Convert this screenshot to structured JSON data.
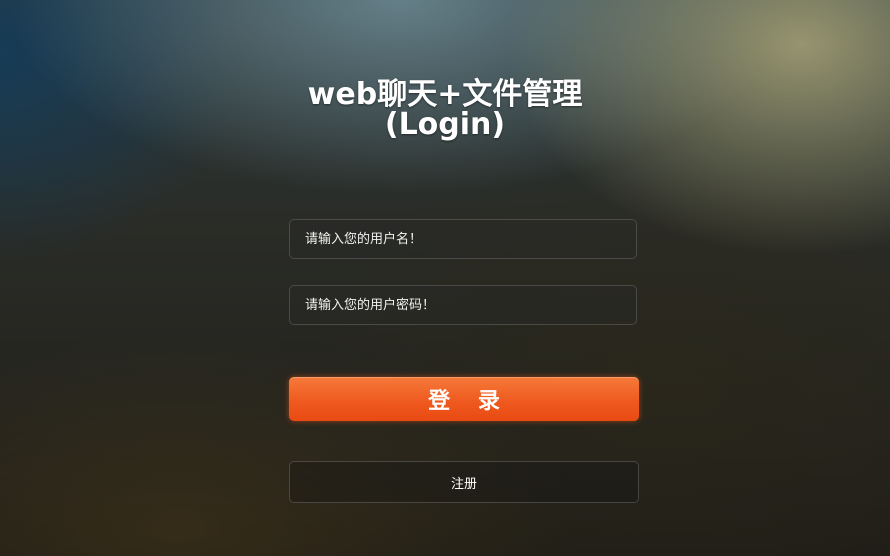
{
  "page": {
    "title_line1": "web聊天+文件管理",
    "title_line2": "(Login)"
  },
  "form": {
    "username_placeholder": "请输入您的用户名！",
    "password_placeholder": "请输入您的用户密码！",
    "login_label": "登 录",
    "register_label": "注册"
  },
  "colors": {
    "login_button": "#ef5a1f",
    "text": "#ffffff"
  }
}
